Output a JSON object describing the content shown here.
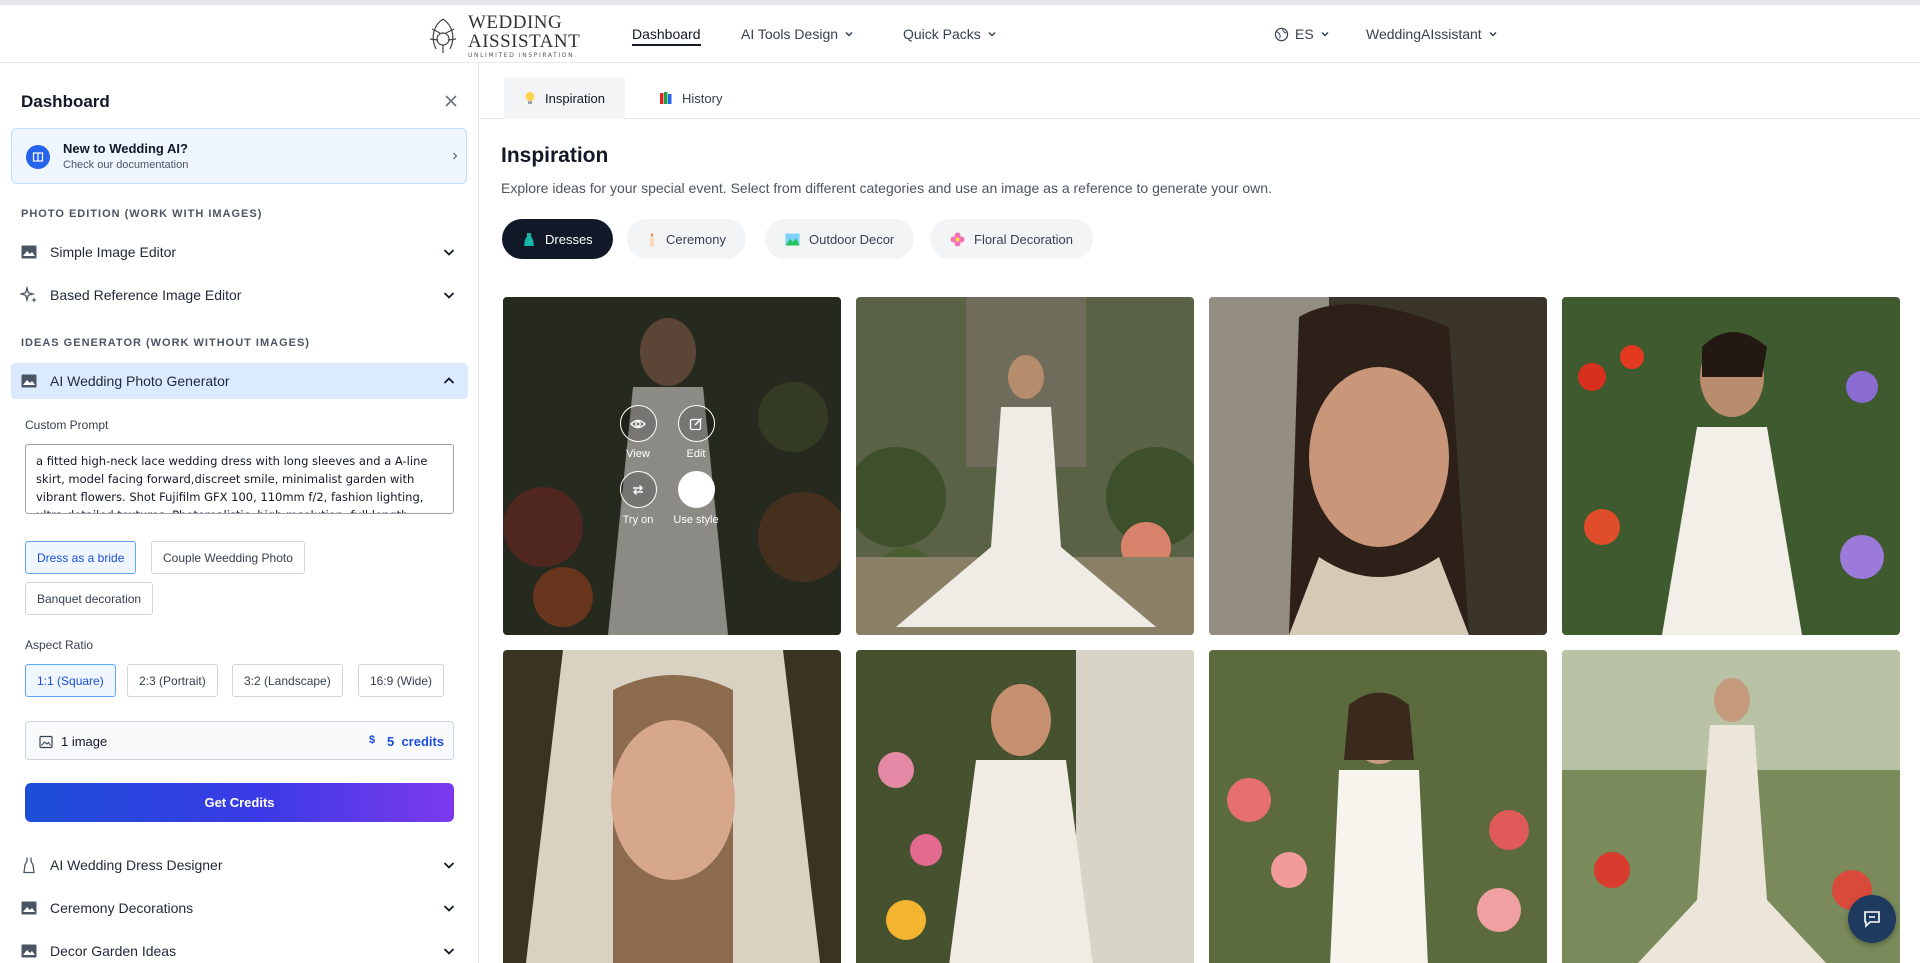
{
  "brand": {
    "line1": "WEDDING",
    "line2": "AISSISTANT",
    "tagline": "UNLIMITED INSPIRATION"
  },
  "nav": {
    "dashboard": "Dashboard",
    "ai_tools": "AI Tools Design",
    "quick_packs": "Quick Packs",
    "language": "ES",
    "user": "WeddingAIssistant"
  },
  "sidebar": {
    "title": "Dashboard",
    "doc_card": {
      "title": "New to Wedding AI?",
      "subtitle": "Check our documentation"
    },
    "section_photo": "PHOTO EDITION (WORK WITH IMAGES)",
    "section_ideas": "IDEAS GENERATOR (WORK WITHOUT IMAGES)",
    "items": [
      {
        "label": "Simple Image Editor",
        "icon": "image-icon",
        "open": false
      },
      {
        "label": "Based Reference Image Editor",
        "icon": "sparkles-icon",
        "open": false
      },
      {
        "label": "AI Wedding Photo Generator",
        "icon": "image-icon",
        "open": true
      },
      {
        "label": "AI Wedding Dress Designer",
        "icon": "dress-icon",
        "open": false
      },
      {
        "label": "Ceremony Decorations",
        "icon": "image-icon",
        "open": false
      },
      {
        "label": "Decor Garden Ideas",
        "icon": "image-icon",
        "open": false
      }
    ],
    "generator": {
      "prompt_label": "Custom Prompt",
      "prompt_value": "a fitted high-neck lace wedding dress with long sleeves and a A-line skirt, model facing forward,discreet smile, minimalist garden with vibrant flowers. Shot Fujifilm GFX 100, 110mm f/2, fashion lighting, ultra-detailed textures. Photorealistic, high resolution, full length",
      "modes": [
        "Dress as a bride",
        "Couple Weedding Photo",
        "Banquet decoration"
      ],
      "selected_mode": "Dress as a bride",
      "aspect_label": "Aspect Ratio",
      "aspects": [
        "1:1 (Square)",
        "2:3 (Portrait)",
        "3:2 (Landscape)",
        "16:9 (Wide)"
      ],
      "selected_aspect": "1:1 (Square)",
      "image_count": "1 image",
      "credits_symbol": "$",
      "credits": "5  credits",
      "get_credits": "Get Credits"
    }
  },
  "main": {
    "tabs": [
      {
        "label": "Inspiration",
        "icon": "lightbulb-icon"
      },
      {
        "label": "History",
        "icon": "books-icon"
      }
    ],
    "title": "Inspiration",
    "description": "Explore ideas for your special event. Select from different categories and use an image as a reference to generate your own.",
    "categories": [
      {
        "label": "Dresses",
        "icon": "dress-icon",
        "color": "#14b8a6"
      },
      {
        "label": "Ceremony",
        "icon": "candle-icon",
        "color": "#fcd9b6"
      },
      {
        "label": "Outdoor Decor",
        "icon": "landscape-icon",
        "color": "#22c55e"
      },
      {
        "label": "Floral Decoration",
        "icon": "flower-icon",
        "color": "#f472b6"
      }
    ],
    "selected_category": "Dresses",
    "overlay_actions": [
      "View",
      "Edit",
      "Try on",
      "Use style"
    ]
  },
  "colors": {
    "accent": "#2563eb",
    "gradient_start": "#1d4ed8",
    "gradient_end": "#7c3aed",
    "dark": "#111827"
  }
}
